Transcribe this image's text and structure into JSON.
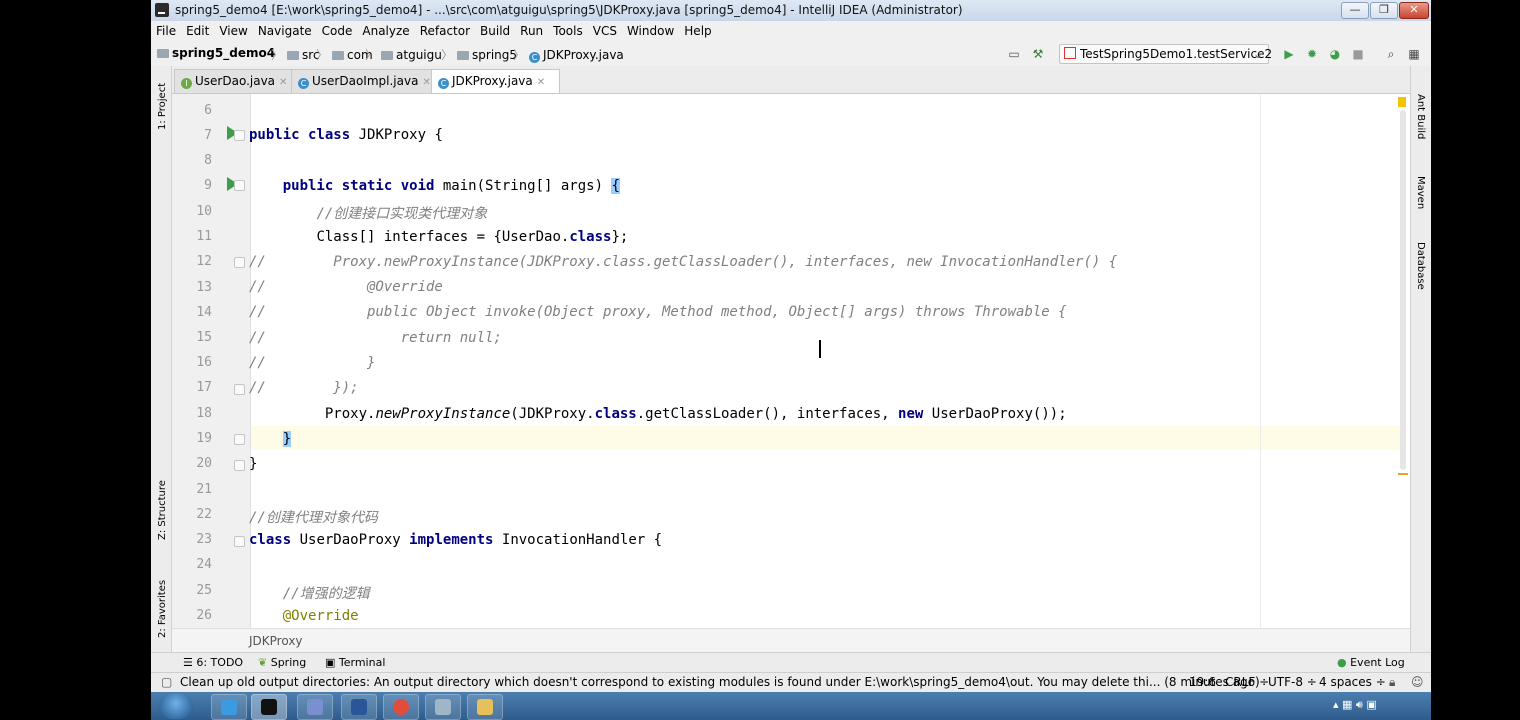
{
  "window": {
    "title": "spring5_demo4 [E:\\work\\spring5_demo4] - ...\\src\\com\\atguigu\\spring5\\JDKProxy.java [spring5_demo4] - IntelliJ IDEA (Administrator)",
    "controls": {
      "minimize": "—",
      "maximize": "❐",
      "close": "✕"
    }
  },
  "menu": [
    "File",
    "Edit",
    "View",
    "Navigate",
    "Code",
    "Analyze",
    "Refactor",
    "Build",
    "Run",
    "Tools",
    "VCS",
    "Window",
    "Help"
  ],
  "navbar": {
    "project": "spring5_demo4",
    "crumbs": [
      "src",
      "com",
      "atguigu",
      "spring5"
    ],
    "file": "JDKProxy.java",
    "run_config": "TestSpring5Demo1.testService2"
  },
  "tabs": [
    {
      "label": "UserDao.java",
      "icon": "interface-icon"
    },
    {
      "label": "UserDaoImpl.java",
      "icon": "class-icon"
    },
    {
      "label": "JDKProxy.java",
      "icon": "class-icon",
      "active": true
    }
  ],
  "left_tools": {
    "project": "1: Project",
    "structure": "Z: Structure",
    "favorites": "2: Favorites"
  },
  "right_tools": {
    "ant": "Ant Build",
    "maven": "Maven",
    "database": "Database"
  },
  "editor": {
    "line_numbers": [
      "6",
      "7",
      "8",
      "9",
      "10",
      "11",
      "12",
      "13",
      "14",
      "15",
      "16",
      "17",
      "18",
      "19",
      "20",
      "21",
      "22",
      "23",
      "24",
      "25",
      "26"
    ],
    "lines": {
      "l7_kw": "public class",
      "l7_rest": " JDKProxy {",
      "l9_kw": "public static void",
      "l9_rest": " main(String[] args) ",
      "l9_brace": "{",
      "l10": "//创建接口实现类代理对象",
      "l11_a": "Class[] interfaces = {UserDao.",
      "l11_kw": "class",
      "l11_b": "};",
      "l12": "//        Proxy.newProxyInstance(JDKProxy.class.getClassLoader(), interfaces, new InvocationHandler() {",
      "l13": "//            @Override",
      "l14": "//            public Object invoke(Object proxy, Method method, Object[] args) throws Throwable {",
      "l15": "//                return null;",
      "l16": "//            }",
      "l17": "//        });",
      "l18_a": "Proxy.",
      "l18_it": "newProxyInstance",
      "l18_b": "(JDKProxy.",
      "l18_kw1": "class",
      "l18_c": ".getClassLoader(), interfaces, ",
      "l18_kw2": "new",
      "l18_d": " UserDaoProxy());",
      "l19": "}",
      "l20": "}",
      "l22": "//创建代理对象代码",
      "l23_kw1": "class",
      "l23_a": " UserDaoProxy ",
      "l23_kw2": "implements",
      "l23_b": " InvocationHandler {",
      "l25": "//增强的逻辑",
      "l26": "@Override"
    },
    "breadcrumb": "JDKProxy"
  },
  "toolwindows": {
    "todo": "6: TODO",
    "spring": "Spring",
    "terminal": "Terminal",
    "event_log": "Event Log"
  },
  "status": {
    "message": "Clean up old output directories: An output directory which doesn't correspond to existing modules is found under E:\\work\\spring5_demo4\\out. You may delete thi... (8 minutes ago)",
    "position": "19:6",
    "line_sep": "CRLF ÷",
    "encoding": "UTF-8 ÷",
    "indent": "4 spaces ÷"
  }
}
